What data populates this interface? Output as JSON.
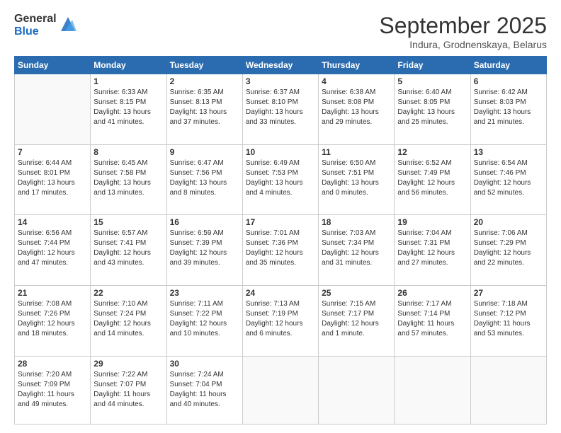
{
  "logo": {
    "general": "General",
    "blue": "Blue"
  },
  "title": "September 2025",
  "subtitle": "Indura, Grodnenskaya, Belarus",
  "days": [
    "Sunday",
    "Monday",
    "Tuesday",
    "Wednesday",
    "Thursday",
    "Friday",
    "Saturday"
  ],
  "weeks": [
    [
      {
        "day": "",
        "lines": []
      },
      {
        "day": "1",
        "lines": [
          "Sunrise: 6:33 AM",
          "Sunset: 8:15 PM",
          "Daylight: 13 hours",
          "and 41 minutes."
        ]
      },
      {
        "day": "2",
        "lines": [
          "Sunrise: 6:35 AM",
          "Sunset: 8:13 PM",
          "Daylight: 13 hours",
          "and 37 minutes."
        ]
      },
      {
        "day": "3",
        "lines": [
          "Sunrise: 6:37 AM",
          "Sunset: 8:10 PM",
          "Daylight: 13 hours",
          "and 33 minutes."
        ]
      },
      {
        "day": "4",
        "lines": [
          "Sunrise: 6:38 AM",
          "Sunset: 8:08 PM",
          "Daylight: 13 hours",
          "and 29 minutes."
        ]
      },
      {
        "day": "5",
        "lines": [
          "Sunrise: 6:40 AM",
          "Sunset: 8:05 PM",
          "Daylight: 13 hours",
          "and 25 minutes."
        ]
      },
      {
        "day": "6",
        "lines": [
          "Sunrise: 6:42 AM",
          "Sunset: 8:03 PM",
          "Daylight: 13 hours",
          "and 21 minutes."
        ]
      }
    ],
    [
      {
        "day": "7",
        "lines": [
          "Sunrise: 6:44 AM",
          "Sunset: 8:01 PM",
          "Daylight: 13 hours",
          "and 17 minutes."
        ]
      },
      {
        "day": "8",
        "lines": [
          "Sunrise: 6:45 AM",
          "Sunset: 7:58 PM",
          "Daylight: 13 hours",
          "and 13 minutes."
        ]
      },
      {
        "day": "9",
        "lines": [
          "Sunrise: 6:47 AM",
          "Sunset: 7:56 PM",
          "Daylight: 13 hours",
          "and 8 minutes."
        ]
      },
      {
        "day": "10",
        "lines": [
          "Sunrise: 6:49 AM",
          "Sunset: 7:53 PM",
          "Daylight: 13 hours",
          "and 4 minutes."
        ]
      },
      {
        "day": "11",
        "lines": [
          "Sunrise: 6:50 AM",
          "Sunset: 7:51 PM",
          "Daylight: 13 hours",
          "and 0 minutes."
        ]
      },
      {
        "day": "12",
        "lines": [
          "Sunrise: 6:52 AM",
          "Sunset: 7:49 PM",
          "Daylight: 12 hours",
          "and 56 minutes."
        ]
      },
      {
        "day": "13",
        "lines": [
          "Sunrise: 6:54 AM",
          "Sunset: 7:46 PM",
          "Daylight: 12 hours",
          "and 52 minutes."
        ]
      }
    ],
    [
      {
        "day": "14",
        "lines": [
          "Sunrise: 6:56 AM",
          "Sunset: 7:44 PM",
          "Daylight: 12 hours",
          "and 47 minutes."
        ]
      },
      {
        "day": "15",
        "lines": [
          "Sunrise: 6:57 AM",
          "Sunset: 7:41 PM",
          "Daylight: 12 hours",
          "and 43 minutes."
        ]
      },
      {
        "day": "16",
        "lines": [
          "Sunrise: 6:59 AM",
          "Sunset: 7:39 PM",
          "Daylight: 12 hours",
          "and 39 minutes."
        ]
      },
      {
        "day": "17",
        "lines": [
          "Sunrise: 7:01 AM",
          "Sunset: 7:36 PM",
          "Daylight: 12 hours",
          "and 35 minutes."
        ]
      },
      {
        "day": "18",
        "lines": [
          "Sunrise: 7:03 AM",
          "Sunset: 7:34 PM",
          "Daylight: 12 hours",
          "and 31 minutes."
        ]
      },
      {
        "day": "19",
        "lines": [
          "Sunrise: 7:04 AM",
          "Sunset: 7:31 PM",
          "Daylight: 12 hours",
          "and 27 minutes."
        ]
      },
      {
        "day": "20",
        "lines": [
          "Sunrise: 7:06 AM",
          "Sunset: 7:29 PM",
          "Daylight: 12 hours",
          "and 22 minutes."
        ]
      }
    ],
    [
      {
        "day": "21",
        "lines": [
          "Sunrise: 7:08 AM",
          "Sunset: 7:26 PM",
          "Daylight: 12 hours",
          "and 18 minutes."
        ]
      },
      {
        "day": "22",
        "lines": [
          "Sunrise: 7:10 AM",
          "Sunset: 7:24 PM",
          "Daylight: 12 hours",
          "and 14 minutes."
        ]
      },
      {
        "day": "23",
        "lines": [
          "Sunrise: 7:11 AM",
          "Sunset: 7:22 PM",
          "Daylight: 12 hours",
          "and 10 minutes."
        ]
      },
      {
        "day": "24",
        "lines": [
          "Sunrise: 7:13 AM",
          "Sunset: 7:19 PM",
          "Daylight: 12 hours",
          "and 6 minutes."
        ]
      },
      {
        "day": "25",
        "lines": [
          "Sunrise: 7:15 AM",
          "Sunset: 7:17 PM",
          "Daylight: 12 hours",
          "and 1 minute."
        ]
      },
      {
        "day": "26",
        "lines": [
          "Sunrise: 7:17 AM",
          "Sunset: 7:14 PM",
          "Daylight: 11 hours",
          "and 57 minutes."
        ]
      },
      {
        "day": "27",
        "lines": [
          "Sunrise: 7:18 AM",
          "Sunset: 7:12 PM",
          "Daylight: 11 hours",
          "and 53 minutes."
        ]
      }
    ],
    [
      {
        "day": "28",
        "lines": [
          "Sunrise: 7:20 AM",
          "Sunset: 7:09 PM",
          "Daylight: 11 hours",
          "and 49 minutes."
        ]
      },
      {
        "day": "29",
        "lines": [
          "Sunrise: 7:22 AM",
          "Sunset: 7:07 PM",
          "Daylight: 11 hours",
          "and 44 minutes."
        ]
      },
      {
        "day": "30",
        "lines": [
          "Sunrise: 7:24 AM",
          "Sunset: 7:04 PM",
          "Daylight: 11 hours",
          "and 40 minutes."
        ]
      },
      {
        "day": "",
        "lines": []
      },
      {
        "day": "",
        "lines": []
      },
      {
        "day": "",
        "lines": []
      },
      {
        "day": "",
        "lines": []
      }
    ]
  ]
}
